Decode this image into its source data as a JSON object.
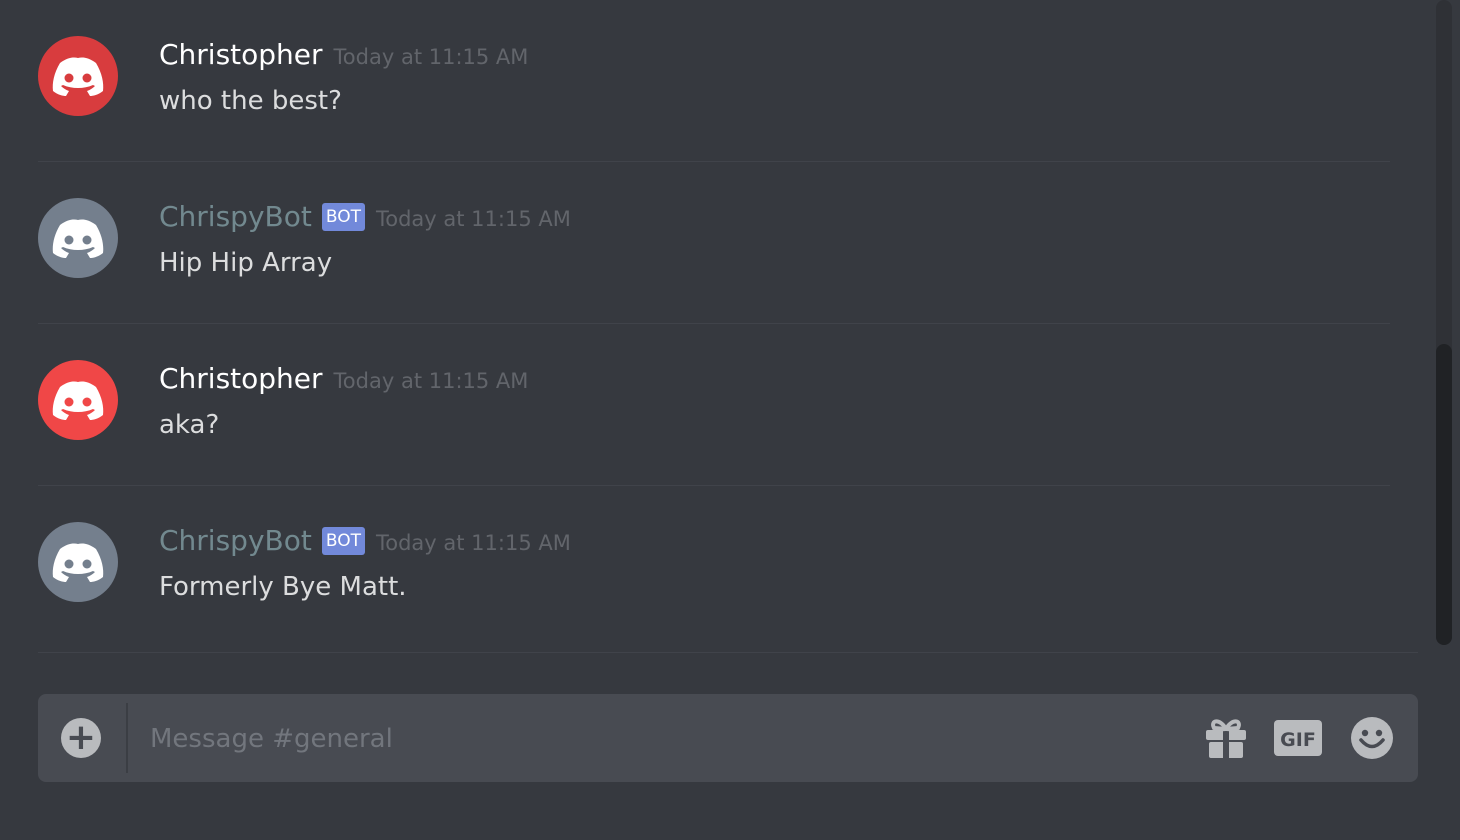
{
  "messages": [
    {
      "author": "Christopher",
      "is_bot": false,
      "timestamp": "Today at 11:15 AM",
      "text": "who the best?",
      "avatar_color": "#d83c3e"
    },
    {
      "author": "ChrispyBot",
      "is_bot": true,
      "bot_tag": "BOT",
      "timestamp": "Today at 11:15 AM",
      "text": "Hip Hip Array",
      "avatar_color": "#747f8d"
    },
    {
      "author": "Christopher",
      "is_bot": false,
      "timestamp": "Today at 11:15 AM",
      "text": "aka?",
      "avatar_color": "#f04747"
    },
    {
      "author": "ChrispyBot",
      "is_bot": true,
      "bot_tag": "BOT",
      "timestamp": "Today at 11:15 AM",
      "text": "Formerly Bye Matt.",
      "avatar_color": "#747f8d"
    }
  ],
  "composer": {
    "placeholder": "Message #general",
    "value": "",
    "attach_icon": "plus-circle-icon",
    "gift_icon": "gift-icon",
    "gif_icon": "gif-icon",
    "emoji_icon": "emoji-icon"
  },
  "colors": {
    "background": "#36393f",
    "bot_tag": "#7289da",
    "composer": "#484b52"
  }
}
